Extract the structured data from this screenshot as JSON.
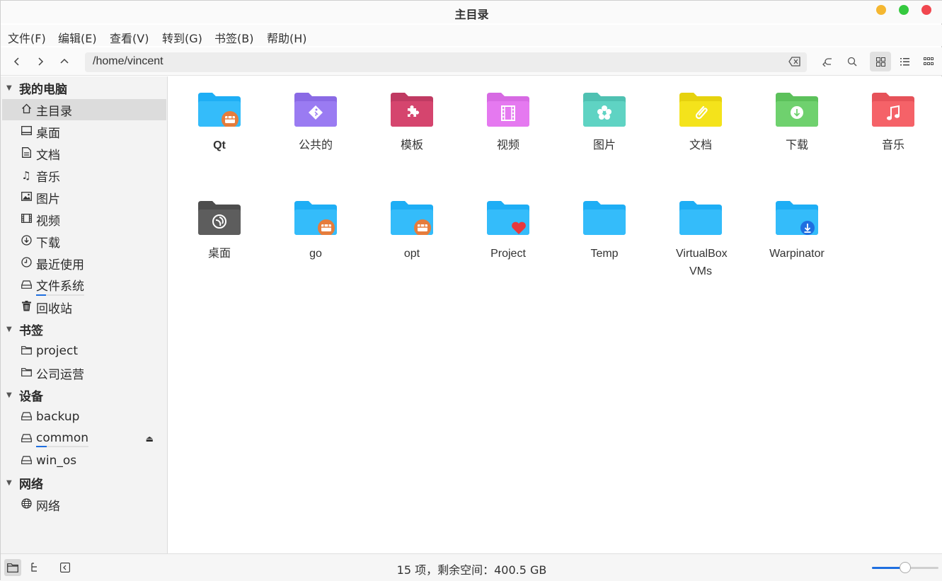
{
  "window": {
    "title": "主目录",
    "controls": {
      "minimize_color": "#f5b731",
      "maximize_color": "#35c93f",
      "close_color": "#f1474f"
    }
  },
  "menubar": [
    {
      "label": "文件(F)"
    },
    {
      "label": "编辑(E)"
    },
    {
      "label": "查看(V)"
    },
    {
      "label": "转到(G)"
    },
    {
      "label": "书签(B)"
    },
    {
      "label": "帮助(H)"
    }
  ],
  "toolbar": {
    "path": "/home/vincent",
    "back_icon": "chevron-left-icon",
    "forward_icon": "chevron-right-icon",
    "up_icon": "chevron-up-icon",
    "active_view": "icon-view"
  },
  "sidebar": {
    "sections": [
      {
        "label": "我的电脑",
        "items": [
          {
            "label": "主目录",
            "icon": "home-icon",
            "selected": true
          },
          {
            "label": "桌面",
            "icon": "desktop-icon"
          },
          {
            "label": "文档",
            "icon": "document-icon"
          },
          {
            "label": "音乐",
            "icon": "music-icon"
          },
          {
            "label": "图片",
            "icon": "picture-icon"
          },
          {
            "label": "视频",
            "icon": "video-icon"
          },
          {
            "label": "下载",
            "icon": "download-icon"
          },
          {
            "label": "最近使用",
            "icon": "clock-icon"
          },
          {
            "label": "文件系统",
            "icon": "drive-icon",
            "usage": 0.2
          },
          {
            "label": "回收站",
            "icon": "trash-icon"
          }
        ]
      },
      {
        "label": "书签",
        "items": [
          {
            "label": "project",
            "icon": "folder-icon"
          },
          {
            "label": "公司运营",
            "icon": "folder-icon"
          }
        ]
      },
      {
        "label": "设备",
        "items": [
          {
            "label": "backup",
            "icon": "drive-icon"
          },
          {
            "label": "common",
            "icon": "drive-icon",
            "usage": 0.2,
            "ejectable": true
          },
          {
            "label": "win_os",
            "icon": "drive-icon"
          }
        ]
      },
      {
        "label": "网络",
        "items": [
          {
            "label": "网络",
            "icon": "globe-icon"
          }
        ]
      }
    ]
  },
  "files": [
    {
      "name": "Qt",
      "color": "#1eaef5",
      "emblem": "package",
      "bold": true
    },
    {
      "name": "公共的",
      "color": "#9a7bf2",
      "emblem": "person"
    },
    {
      "name": "模板",
      "color": "#d5456e",
      "emblem": "puzzle"
    },
    {
      "name": "视频",
      "color": "#e579f0",
      "emblem": "film"
    },
    {
      "name": "图片",
      "color": "#5fd3c3",
      "emblem": "flower"
    },
    {
      "name": "文档",
      "color": "#f4e31b",
      "emblem": "paperclip"
    },
    {
      "name": "下载",
      "color": "#6fd16e",
      "emblem": "download"
    },
    {
      "name": "音乐",
      "color": "#f56268",
      "emblem": "note"
    },
    {
      "name": "桌面",
      "color": "#5d5d5d",
      "emblem": "swirl"
    },
    {
      "name": "go",
      "color": "#1eaef5",
      "emblem": "package"
    },
    {
      "name": "opt",
      "color": "#1eaef5",
      "emblem": "package"
    },
    {
      "name": "Project",
      "color": "#1eaef5",
      "emblem": "heart"
    },
    {
      "name": "Temp",
      "color": "#1eaef5",
      "emblem": ""
    },
    {
      "name": "VirtualBox VMs",
      "color": "#1eaef5",
      "emblem": ""
    },
    {
      "name": "Warpinator",
      "color": "#1eaef5",
      "emblem": "blue-download"
    }
  ],
  "status": {
    "text": "15 项，剩余空间：400.5 GB",
    "zoom": 0.5
  }
}
